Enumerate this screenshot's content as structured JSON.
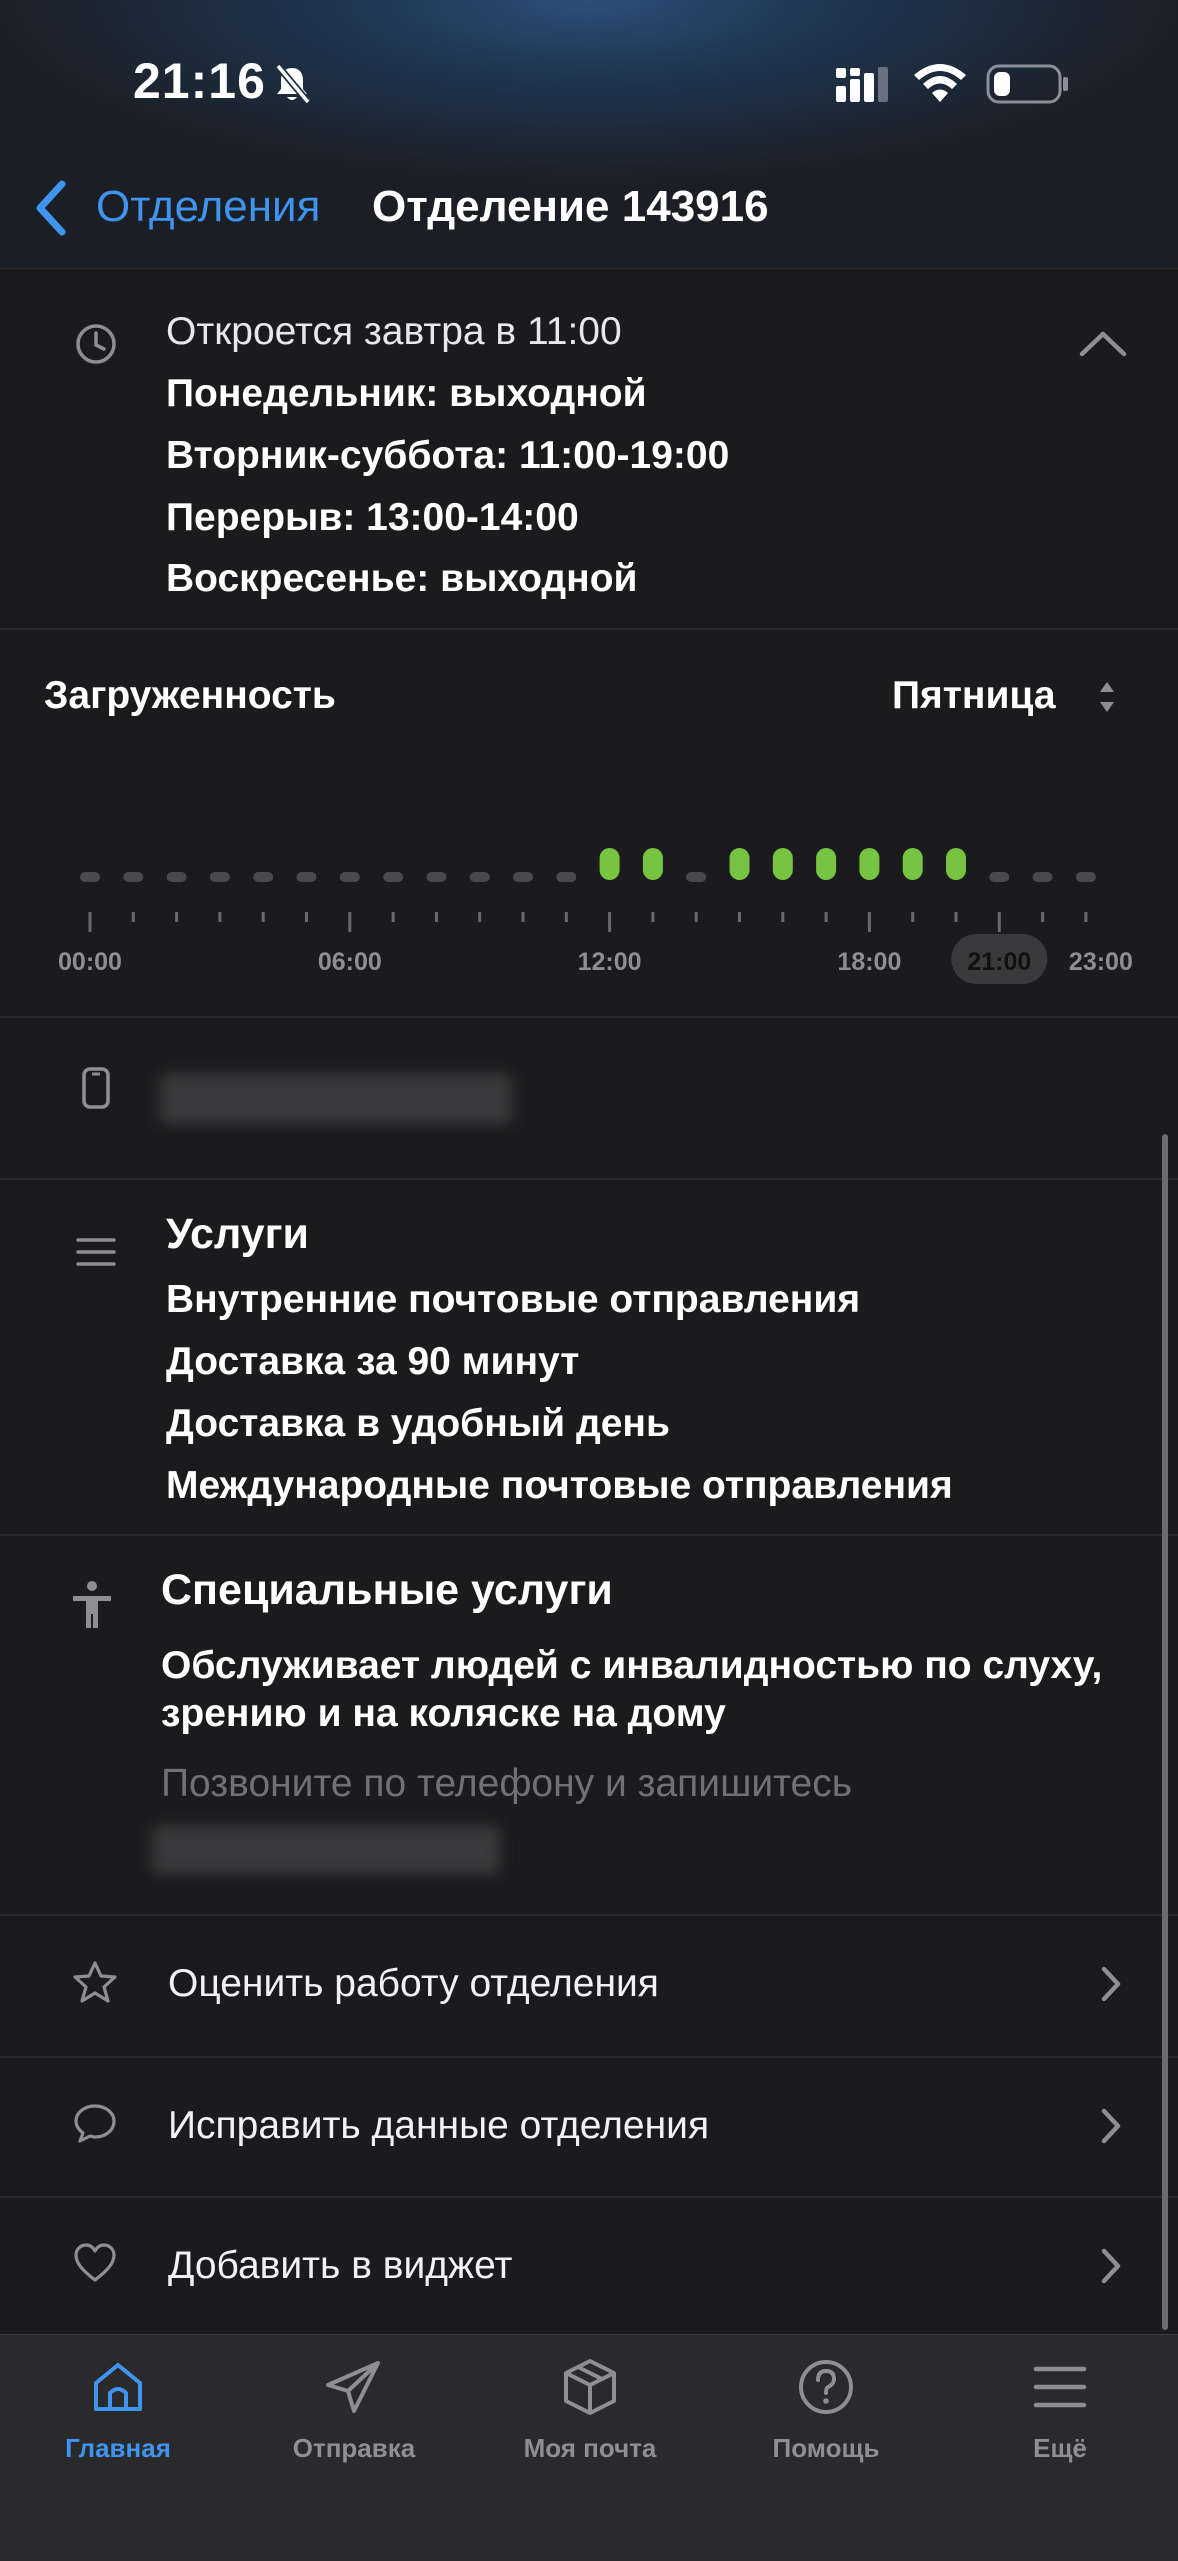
{
  "status_bar": {
    "time": "21:16"
  },
  "nav": {
    "back_label": "Отделения",
    "title": "Отделение 143916"
  },
  "hours": {
    "status": "Откроется завтра в 11:00",
    "lines": [
      "Понедельник: выходной",
      "Вторник-суббота: 11:00-19:00",
      "Перерыв: 13:00-14:00",
      "Воскресенье: выходной"
    ]
  },
  "load": {
    "title": "Загруженность",
    "day": "Пятница",
    "current_time_label": "21:00",
    "accent_color": "#76c442",
    "inactive_color": "#4a4a4c"
  },
  "chart_data": {
    "type": "bar",
    "categories": [
      "00:00",
      "06:00",
      "12:00",
      "18:00",
      "21:00",
      "23:00"
    ],
    "hours": [
      0,
      1,
      2,
      3,
      4,
      5,
      6,
      7,
      8,
      9,
      10,
      11,
      12,
      13,
      14,
      15,
      16,
      17,
      18,
      19,
      20,
      21,
      22,
      23
    ],
    "active": [
      0,
      0,
      0,
      0,
      0,
      0,
      0,
      0,
      0,
      0,
      0,
      0,
      1,
      1,
      0,
      1,
      1,
      1,
      1,
      1,
      1,
      0,
      0,
      0,
      0
    ],
    "tick_labels": [
      "00:00",
      "06:00",
      "12:00",
      "18:00",
      "21:00",
      "23:00"
    ],
    "highlight": "21:00"
  },
  "services": {
    "title": "Услуги",
    "items": [
      "Внутренние почтовые отправления",
      "Доставка за 90 минут",
      "Доставка в удобный день",
      "Международные почтовые отправления"
    ]
  },
  "special": {
    "title": "Специальные услуги",
    "description": "Обслуживает людей с инвалидностью по слуху, зрению и на коляске на дому",
    "hint": "Позвоните по телефону и запишитесь"
  },
  "actions": [
    {
      "label": "Оценить работу отделения",
      "icon": "star-icon"
    },
    {
      "label": "Исправить данные отделения",
      "icon": "chat-bubble-icon"
    },
    {
      "label": "Добавить в виджет",
      "icon": "heart-icon"
    }
  ],
  "tabbar": {
    "accent_color": "#3f94f0",
    "tabs": [
      {
        "label": "Главная",
        "icon": "home-icon"
      },
      {
        "label": "Отправка",
        "icon": "paper-plane-icon"
      },
      {
        "label": "Моя почта",
        "icon": "box-icon"
      },
      {
        "label": "Помощь",
        "icon": "help-icon"
      },
      {
        "label": "Ещё",
        "icon": "menu-icon"
      }
    ]
  }
}
